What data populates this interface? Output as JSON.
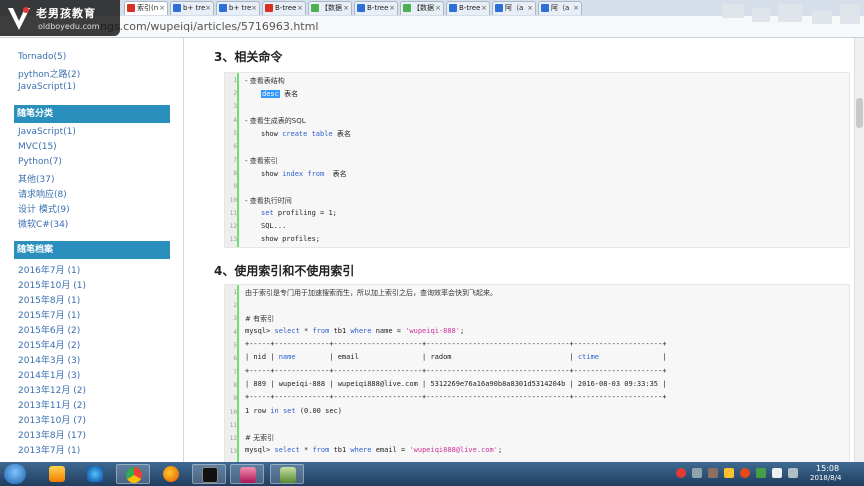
{
  "browser": {
    "tabs": [
      {
        "label": "索引(n",
        "color": "#d93025"
      },
      {
        "label": "b+ tre",
        "color": "#2c6fd6"
      },
      {
        "label": "b+ tre",
        "color": "#2c6fd6"
      },
      {
        "label": "B-tree",
        "color": "#d93025"
      },
      {
        "label": "【数据",
        "color": "#4caf50"
      },
      {
        "label": "B-tree",
        "color": "#2c6fd6"
      },
      {
        "label": "【数据",
        "color": "#4caf50"
      },
      {
        "label": "B-tree",
        "color": "#2c6fd6"
      },
      {
        "label": "阿（a",
        "color": "#2c6fd6"
      },
      {
        "label": "阿（a",
        "color": "#2c6fd6"
      }
    ],
    "url": "ngs.com/wupeiqi/articles/5716963.html"
  },
  "logo": {
    "cn": "老男孩教育",
    "en": "oldboyedu.com"
  },
  "sidebar": {
    "top_links": [
      "Tornado(5)",
      "python之路(2)",
      "JavaScript(1)"
    ],
    "section1": {
      "title": "随笔分类",
      "items": [
        "JavaScript(1)",
        "MVC(15)",
        "Python(7)",
        "其他(37)",
        "请求响应(8)",
        "设计 模式(9)",
        "微软C#(34)"
      ]
    },
    "section2": {
      "title": "随笔档案",
      "items": [
        "2016年7月 (1)",
        "2015年10月 (1)",
        "2015年8月 (1)",
        "2015年7月 (1)",
        "2015年6月 (2)",
        "2015年4月 (2)",
        "2014年3月 (3)",
        "2014年1月 (3)",
        "2013年12月 (2)",
        "2013年11月 (2)",
        "2013年10月 (7)",
        "2013年8月 (17)",
        "2013年7月 (1)"
      ]
    }
  },
  "article": {
    "h3_related": "3、相关命令",
    "h4_index": "4、使用索引和不使用索引",
    "cmd": {
      "c1": "- 查看表结构",
      "c1_code_hl": "desc",
      "c1_code_rest": " 表名",
      "c2": "- 查看生成表的SQL",
      "c2_show": "show ",
      "c2_kw": "create table",
      "c2_tail": " 表名",
      "c3": "- 查看索引",
      "c3_show": "show ",
      "c3_kw": "index from",
      "c3_tail": "  表名",
      "c4": "- 查看执行时间",
      "c4_set": "set",
      "c4_rest": " profiling = 1;",
      "c4_sql": "SQL...",
      "c4_show": "show profiles;"
    },
    "lines_cmd": [
      "1",
      "2",
      "3",
      "4",
      "5",
      "6",
      "7",
      "8",
      "9",
      "10",
      "11",
      "12",
      "13"
    ],
    "idx": {
      "note": "由于索引是专门用于加速搜索而生，所以加上索引之后，查询效率会快到飞起来。",
      "sub1": "# 有索引",
      "q1_a": "mysql> ",
      "q1_b": "select",
      "q1_c": " * ",
      "q1_d": "from",
      "q1_e": " tb1 ",
      "q1_f": "where",
      "q1_g": " name = ",
      "q1_h": "'wupeiqi-888'",
      "q1_i": ";",
      "border": "+-----+-------------+---------------------+----------------------------------+---------------------+",
      "hdr_a": "| nid | ",
      "hdr_b": "name",
      "hdr_c": "        | email               | radom                            | ",
      "hdr_d": "ctime",
      "hdr_e": "               |",
      "row": "| 889 | wupeiqi-888 | wupeiqi888@live.com | 5312269e76a16a90b8a8301d5314204b | 2016-08-03 09:33:35 |",
      "res_a": "1 row ",
      "res_b": "in",
      "res_c": " ",
      "res_d": "set",
      "res_e": " (0.00 sec)",
      "sub2": "# 无索引",
      "q2_a": "mysql> ",
      "q2_b": "select",
      "q2_c": " * ",
      "q2_d": "from",
      "q2_e": " tb1 ",
      "q2_f": "where",
      "q2_g": " email = ",
      "q2_h": "'wupeiqi888@live.com'",
      "q2_i": ";"
    },
    "lines_idx": [
      "1",
      "2",
      "3",
      "4",
      "5",
      "6",
      "7",
      "8",
      "9",
      "10",
      "11",
      "12",
      "13"
    ]
  },
  "taskbar": {
    "time": "15:08",
    "date": "2018/8/4"
  }
}
